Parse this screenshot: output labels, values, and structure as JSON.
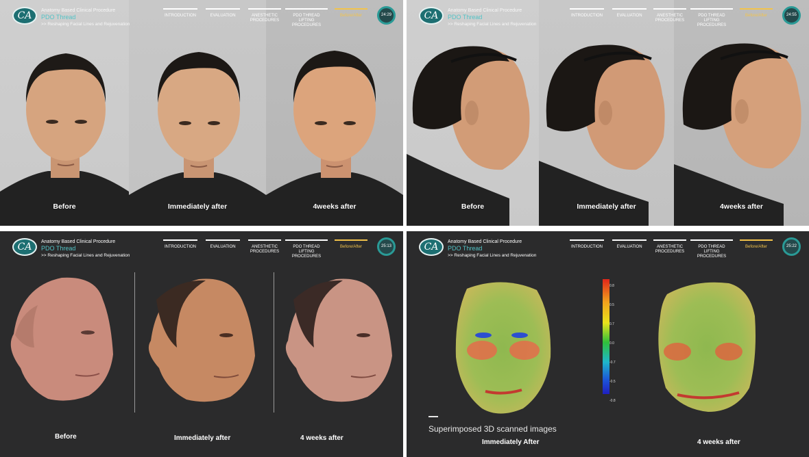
{
  "header": {
    "brand_line1": "Anatomy Based Clinical Procedure",
    "brand_title": "PDO Thread",
    "brand_subtitle": ">> Reshaping Facial Lines and Rejuvenation",
    "logo_text": "CA",
    "nav": [
      {
        "label": "INTRODUCTION"
      },
      {
        "label": "EVALUATION"
      },
      {
        "label": "ANESTHETIC PROCEDURES"
      },
      {
        "label": "PDO THREAD LIFTING PROCEDURES"
      },
      {
        "label": "Before/After"
      }
    ]
  },
  "panels": [
    {
      "timer": "24:29",
      "captions": [
        "Before",
        "Immediately after",
        "4weeks after"
      ]
    },
    {
      "timer": "24:55",
      "captions": [
        "Before",
        "Immediately after",
        "4weeks after"
      ]
    },
    {
      "timer": "25:13",
      "captions": [
        "Before",
        "Immediately after",
        "4 weeks after"
      ]
    },
    {
      "timer": "25:22",
      "title": "Superimposed 3D scanned images",
      "captions": [
        "Immediately After",
        "4 weeks after"
      ],
      "scale_ticks": [
        "0.8",
        "0.5",
        "0.7",
        "0.0",
        "-0.7",
        "-0.5",
        "-0.8"
      ]
    }
  ],
  "colors": {
    "accent_teal": "#53c3c6",
    "active_tab": "#f2c34b",
    "dark_bg": "#2b2b2c"
  }
}
